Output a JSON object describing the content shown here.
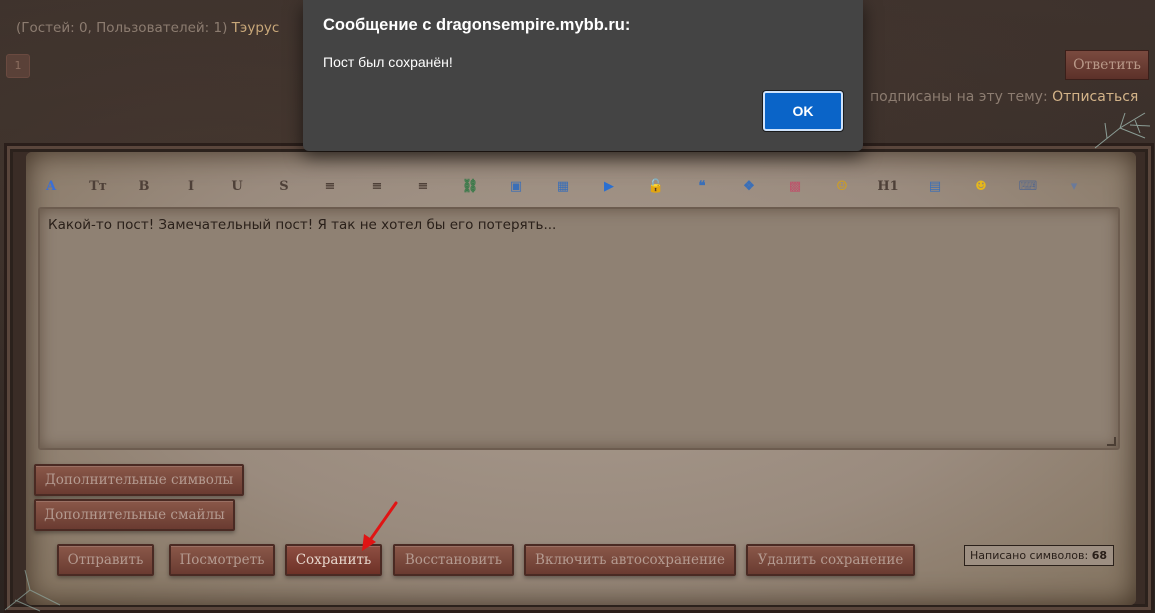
{
  "header": {
    "online_prefix": "(Гостей: 0, Пользователей: 1) ",
    "online_user": "Тэурус",
    "page_number": "1",
    "reply_label": "Ответить",
    "subscribe_text": "подписаны на эту тему: ",
    "unsubscribe_link": "Отписаться"
  },
  "editor": {
    "text": "Какой-то пост! Замечательный пост! Я так не хотел бы его потерять...",
    "toolbar": [
      {
        "icon": "font-color-icon",
        "glyph": "A",
        "color": "#3a6fd8"
      },
      {
        "icon": "font-size-icon",
        "glyph": "Tт",
        "color": "#4e4038"
      },
      {
        "icon": "bold-icon",
        "glyph": "B",
        "color": "#4e4038"
      },
      {
        "icon": "italic-icon",
        "glyph": "I",
        "color": "#4e4038"
      },
      {
        "icon": "underline-icon",
        "glyph": "U",
        "color": "#4e4038"
      },
      {
        "icon": "strikethrough-icon",
        "glyph": "S",
        "color": "#4e4038"
      },
      {
        "icon": "align-left-icon",
        "glyph": "≡",
        "color": "#4e4038"
      },
      {
        "icon": "align-center-icon",
        "glyph": "≡",
        "color": "#4e4038"
      },
      {
        "icon": "align-right-icon",
        "glyph": "≡",
        "color": "#4e4038"
      },
      {
        "icon": "link-icon",
        "glyph": "⛓",
        "color": "#3b7a4a"
      },
      {
        "icon": "book-icon",
        "glyph": "▣",
        "color": "#3a6fb8"
      },
      {
        "icon": "image-icon",
        "glyph": "▦",
        "color": "#3a6fb8"
      },
      {
        "icon": "video-icon",
        "glyph": "▶",
        "color": "#2a6fd0"
      },
      {
        "icon": "lock-icon",
        "glyph": "🔓",
        "color": "#c8a020"
      },
      {
        "icon": "quote-icon",
        "glyph": "❝",
        "color": "#3a6fb8"
      },
      {
        "icon": "code-icon",
        "glyph": "❖",
        "color": "#3a6fb8"
      },
      {
        "icon": "color-grid-icon",
        "glyph": "▩",
        "color": "#c0506a"
      },
      {
        "icon": "emoji-icon",
        "glyph": "☺",
        "color": "#d4a018"
      },
      {
        "icon": "heading-icon",
        "glyph": "H1",
        "color": "#4e4038"
      },
      {
        "icon": "table-icon",
        "glyph": "▤",
        "color": "#3a6fb8"
      },
      {
        "icon": "smiley-icon",
        "glyph": "☻",
        "color": "#e6b81a"
      },
      {
        "icon": "keyboard-icon",
        "glyph": "⌨",
        "color": "#5a6a8a"
      },
      {
        "icon": "more-dropdown-icon",
        "glyph": "▾",
        "color": "#6a7a9a"
      }
    ],
    "extra_symbols_label": "Дополнительные символы",
    "extra_smiles_label": "Дополнительные смайлы",
    "buttons": {
      "submit": "Отправить",
      "preview": "Посмотреть",
      "save": "Сохранить",
      "restore": "Восстановить",
      "autosave": "Включить автосохранение",
      "delete_save": "Удалить сохранение"
    },
    "counter_label": "Написано символов: ",
    "counter_value": "68"
  },
  "dialog": {
    "title": "Сообщение с dragonsempire.mybb.ru:",
    "message": "Пост был сохранён!",
    "ok_label": "OK"
  },
  "colors": {
    "accent_button": "#6a3b31",
    "dialog_bg": "#444444",
    "ok_button": "#0a64c8",
    "link": "#d4b489"
  }
}
